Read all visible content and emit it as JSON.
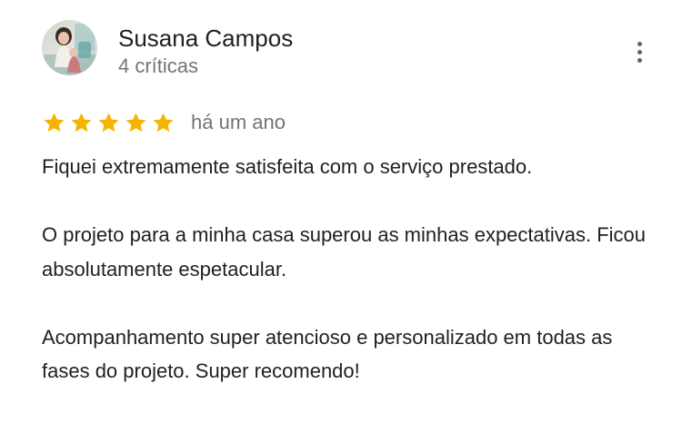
{
  "review": {
    "reviewer_name": "Susana Campos",
    "review_count": "4 críticas",
    "rating": 5,
    "max_rating": 5,
    "star_color": "#f4b400",
    "date": "há um ano",
    "paragraphs": [
      "Fiquei extremamente satisfeita com o serviço prestado.",
      "O projeto para a minha casa superou as minhas expectativas. Ficou absolutamente espetacular.",
      "Acompanhamento super atencioso e personalizado em todas as fases do projeto. Super recomendo!"
    ],
    "avatar_icon": "user-photo",
    "menu_icon": "more-vert-icon"
  }
}
